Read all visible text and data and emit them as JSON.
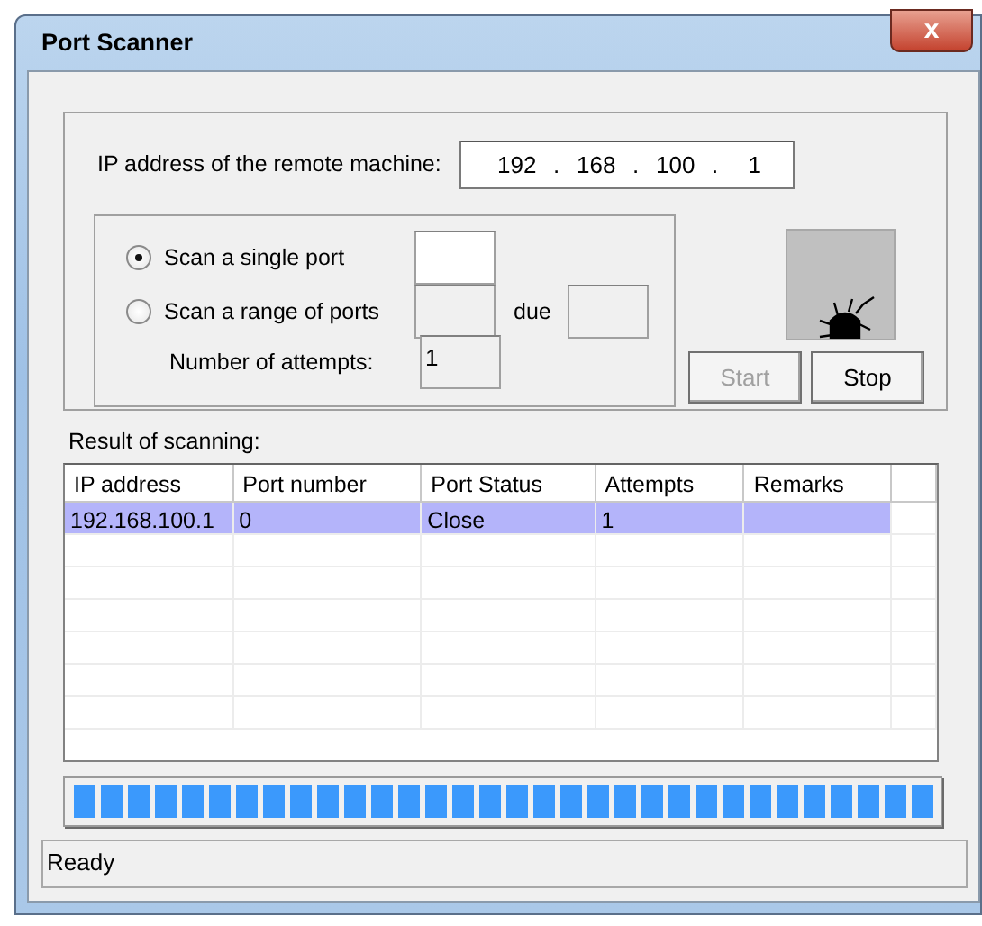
{
  "window": {
    "title": "Port Scanner",
    "close": "x"
  },
  "ip": {
    "label": "IP address of the remote machine:",
    "octets": [
      "192",
      "168",
      "100",
      "1"
    ],
    "separators": [
      ".",
      ".",
      "."
    ]
  },
  "scan_modes": [
    {
      "label": "Scan a single port",
      "selected": true
    },
    {
      "label": "Scan a range of ports",
      "selected": false
    }
  ],
  "range_separator": "due",
  "attempts": {
    "label": "Number of attempts:",
    "value": "1"
  },
  "buttons": [
    {
      "label": "Start",
      "disabled": true
    },
    {
      "label": "Stop",
      "disabled": false
    }
  ],
  "results": {
    "label": "Result of scanning:",
    "columns": [
      "IP address",
      "Port number",
      "Port Status",
      "Attempts",
      "Remarks"
    ],
    "rows": [
      {
        "cells": [
          "192.168.100.1",
          "0",
          "Close",
          "1",
          ""
        ],
        "selected": true
      }
    ]
  },
  "progress": {
    "level": 1
  },
  "status_bar": "Ready"
}
